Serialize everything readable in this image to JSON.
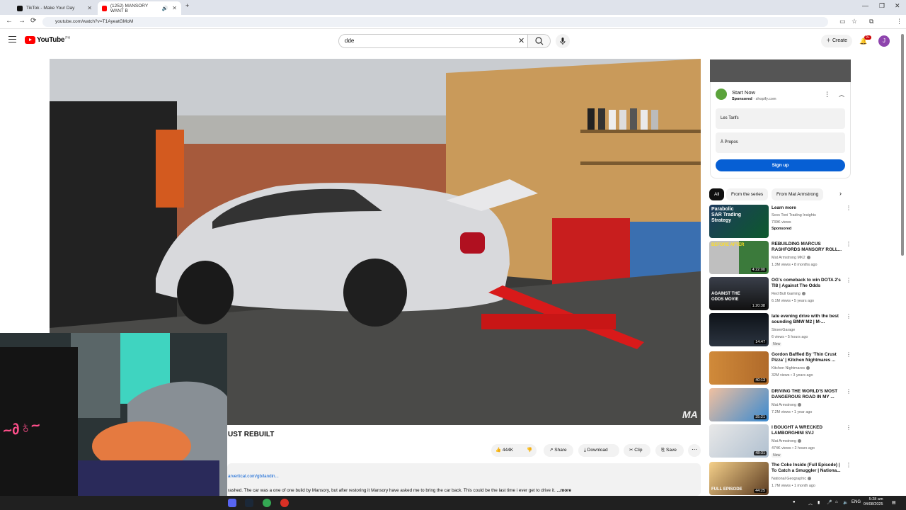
{
  "browser": {
    "tabs": [
      {
        "title": "TikTok - Make Your Day",
        "active": false
      },
      {
        "title": "(1252) MANSORY WANT B",
        "active": true
      }
    ],
    "url": "youtube.com/watch?v=T1AyeatGMoM",
    "profile_initial": "J"
  },
  "header": {
    "logo_text": "YouTube",
    "logo_region": "PH",
    "search_value": "dde",
    "create_label": "Create",
    "notifications": "9+",
    "avatar_initial": "J"
  },
  "video": {
    "watermark": "MA",
    "title_partial": "UST REBUILT",
    "likes": "444K",
    "share": "Share",
    "download": "Download",
    "clip": "Clip",
    "save": "Save",
    "desc_link": "arvertical.com/gb/landin...",
    "desc_text": "rashed. The car was a one of one build by Mansory, but after restoring it Mansory have asked me to bring the car back. This could be the last time i ever get to drive it.",
    "desc_more": "...more"
  },
  "ad": {
    "title": "Start Now",
    "sponsored_label": "Sponsored",
    "domain": "shopify.com",
    "row1": "Les Tarifs",
    "row2": "À Propos",
    "cta": "Sign up"
  },
  "chips": [
    "All",
    "From the series",
    "From Mat Armstrong"
  ],
  "recommendations": [
    {
      "title": "Learn more",
      "channel": "Sovs Toni Trading Insights",
      "meta": "739K views",
      "badge": "",
      "sponsored": "Sponsored",
      "duration": "",
      "thumb_text": "Parabolic SAR Trading Strategy"
    },
    {
      "title": "REBUILDING MARCUS RASHFORDS MANSORY ROLL...",
      "channel": "Mat Armstrong MK2",
      "meta": "1.3M views • 8 months ago",
      "badge": "",
      "sponsored": "",
      "duration": "4:22:00",
      "thumb_text": "BEFORE AFTER"
    },
    {
      "title": "OG's comeback to win DOTA 2's TI8 | Against The Odds",
      "channel": "Red Bull Gaming",
      "meta": "6.1M views • 5 years ago",
      "badge": "",
      "sponsored": "",
      "duration": "1:20:38",
      "thumb_text": "AGAINST THE ODDS MOVIE"
    },
    {
      "title": "late evening drive with the best sounding BMW M2 | M-...",
      "channel": "SirsenGarage",
      "meta": "6 views • 5 hours ago",
      "badge": "New",
      "sponsored": "",
      "duration": "14:47",
      "thumb_text": ""
    },
    {
      "title": "Gordon Baffled By 'Thin Crust Pizza' | Kitchen Nightmares ...",
      "channel": "Kitchen Nightmares",
      "meta": "32M views • 3 years ago",
      "badge": "",
      "sponsored": "",
      "duration": "40:13",
      "thumb_text": ""
    },
    {
      "title": "DRIVING THE WORLD'S MOST DANGEROUS ROAD IN MY ...",
      "channel": "Mat Armstrong",
      "meta": "7.2M views • 1 year ago",
      "badge": "",
      "sponsored": "",
      "duration": "35:21",
      "thumb_text": ""
    },
    {
      "title": "I BOUGHT A WRECKED LAMBORGHINI SVJ",
      "channel": "Mat Armstrong",
      "meta": "474K views • 2 hours ago",
      "badge": "New",
      "sponsored": "",
      "duration": "48:31",
      "thumb_text": ""
    },
    {
      "title": "The Coke Inside (Full Episode) | To Catch a Smuggler | Nationa...",
      "channel": "National Geographic",
      "meta": "1.7M views • 1 month ago",
      "badge": "",
      "sponsored": "",
      "duration": "44:25",
      "thumb_text": "FULL EPISODE"
    }
  ],
  "taskbar": {
    "lang": "ENG",
    "time": "5:28 am",
    "date": "04/08/2025"
  },
  "colors": {
    "accent": "#065fd4",
    "brand": "#ff0000"
  }
}
